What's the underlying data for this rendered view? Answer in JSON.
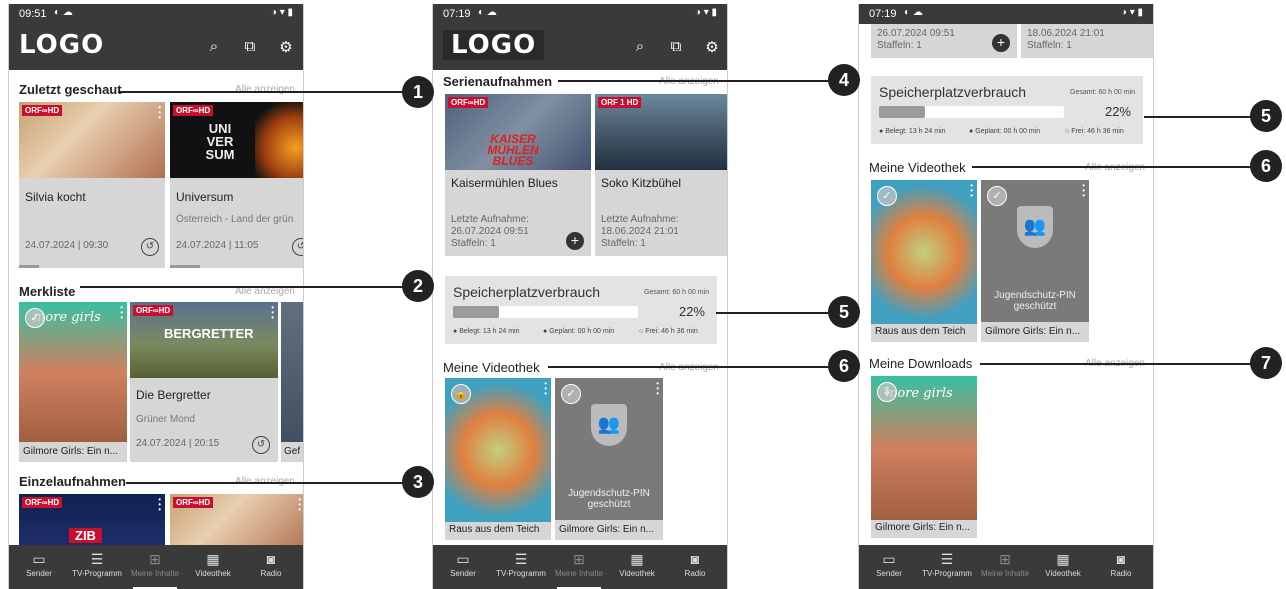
{
  "status": {
    "time1": "09:51",
    "time2": "07:19",
    "time3": "07:19",
    "left": "◐ ☁",
    "right": "◑ ▾ ▮"
  },
  "logo": "LOGO",
  "icons": {
    "search": "search-icon",
    "cast": "cast-icon",
    "settings": "gear-icon"
  },
  "p1": {
    "s1": {
      "title": "Zuletzt geschaut",
      "link": "Alle anzeigen"
    },
    "c1": {
      "badge": "ORF∞HD",
      "title": "Silvia kocht",
      "meta": "24.07.2024 | 09:30"
    },
    "c2": {
      "badge": "ORF∞HD",
      "thumbtext": "UNI VER SUM",
      "title": "Universum",
      "sub": "Österreich - Land der grün",
      "meta": "24.07.2024 | 11:05"
    },
    "s2": {
      "title": "Merkliste",
      "link": "Alle anzeigen"
    },
    "c3": {
      "thumbtext": "more girls",
      "title": "Gilmore Girls: Ein n..."
    },
    "c4": {
      "badge": "ORF∞HD",
      "thumbtext": "BERGRETTER",
      "title": "Die Bergretter",
      "sub": "Grüner Mond",
      "meta": "24.07.2024 | 20:15"
    },
    "c5": {
      "title": "Gef"
    },
    "s3": {
      "title": "Einzelaufnahmen",
      "link": "Alle anzeigen"
    },
    "c6": {
      "badge": "ORF∞HD",
      "thumbtext": "ZIB"
    },
    "c7": {
      "badge": "ORF∞HD"
    }
  },
  "p2": {
    "s1": {
      "title": "Serienaufnahmen",
      "link": "Alle anzeigen"
    },
    "c1": {
      "badge": "ORF∞HD",
      "thumbtext": "KAISER MÜHLEN BLUES",
      "title": "Kaisermühlen Blues",
      "meta1": "Letzte Aufnahme:",
      "meta2": "26.07.2024 09:51",
      "meta3": "Staffeln: 1"
    },
    "c2": {
      "badge": "ORF 1 HD",
      "title": "Soko Kitzbühel",
      "meta1": "Letzte Aufnahme:",
      "meta2": "18.06.2024 21:01",
      "meta3": "Staffeln: 1"
    },
    "s2": {
      "title": "Meine Videothek",
      "link": "Alle anzeigen"
    },
    "c3": {
      "title": "Raus aus dem Teich"
    },
    "c4": {
      "pin": "Jugendschutz-PIN geschützt",
      "title": "Gilmore Girls: Ein n..."
    }
  },
  "p3": {
    "top1": {
      "meta1": "26.07.2024 09:51",
      "meta2": "Staffeln: 1"
    },
    "top2": {
      "meta1": "18.06.2024 21:01",
      "meta2": "Staffeln: 1"
    },
    "s2": {
      "title": "Meine Videothek",
      "link": "Alle anzeigen"
    },
    "c3": {
      "title": "Raus aus dem Teich"
    },
    "c4": {
      "pin": "Jugendschutz-PIN geschützt",
      "title": "Gilmore Girls: Ein n..."
    },
    "s3": {
      "title": "Meine Downloads",
      "link": "Alle anzeigen"
    },
    "c5": {
      "thumbtext": "more girls",
      "title": "Gilmore Girls: Ein n..."
    }
  },
  "storage": {
    "title": "Speicherplatzverbrauch",
    "total": "Gesamt: 60 h 00 min",
    "pct": "22%",
    "fill": 0.22,
    "used": "Belegt: 13 h 24 min",
    "planned": "Geplant: 00 h 00 min",
    "free": "Frei: 46 h 36 min"
  },
  "nav": {
    "sender": "Sender",
    "tv": "TV-Programm",
    "meine": "Meine Inhalte",
    "videothek": "Videothek",
    "radio": "Radio"
  },
  "callouts": [
    "1",
    "2",
    "3",
    "4",
    "5",
    "6",
    "5",
    "6",
    "7"
  ]
}
